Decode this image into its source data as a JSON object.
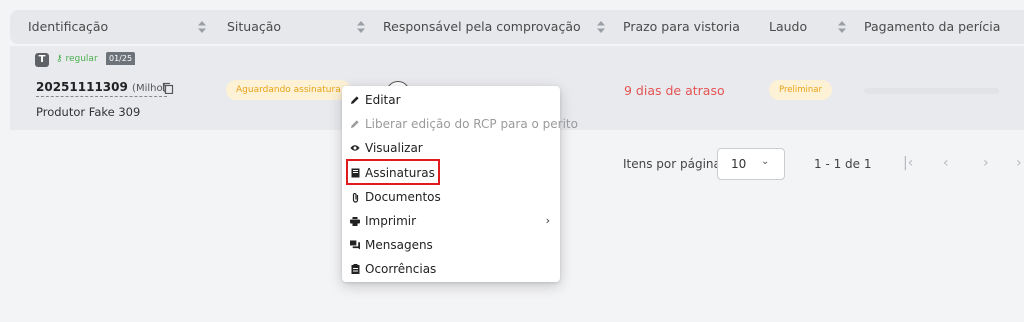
{
  "table": {
    "columns": [
      {
        "label": "Identificação"
      },
      {
        "label": "Situação"
      },
      {
        "label": "Responsável pela comprovação"
      },
      {
        "label": "Prazo para vistoria"
      },
      {
        "label": "Laudo"
      },
      {
        "label": "Pagamento da perícia"
      }
    ],
    "row": {
      "type_badge": "T",
      "regular_label": "regular",
      "count_badge": "01/25",
      "id_number": "20251111309",
      "crop": "(Milho)",
      "producer": "Produtor Fake 309",
      "status": "Aguardando assinatura",
      "deadline": "9 dias de atraso",
      "laudo": "Preliminar",
      "payment_progress": 0
    }
  },
  "pagination": {
    "items_per_page_label": "Itens por página",
    "items_per_page_value": "10",
    "range_label": "1 - 1 de 1"
  },
  "menu": {
    "items": [
      {
        "label": "Editar",
        "icon": "pencil-icon",
        "disabled": false
      },
      {
        "label": "Liberar edição do RCP para o perito",
        "icon": "pencil-icon",
        "disabled": true
      },
      {
        "label": "Visualizar",
        "icon": "eye-icon",
        "disabled": false
      },
      {
        "label": "Assinaturas",
        "icon": "book-icon",
        "disabled": false,
        "highlighted": true
      },
      {
        "label": "Documentos",
        "icon": "paperclip-icon",
        "disabled": false
      },
      {
        "label": "Imprimir",
        "icon": "printer-icon",
        "disabled": false,
        "submenu": true
      },
      {
        "label": "Mensagens",
        "icon": "chat-icon",
        "disabled": false
      },
      {
        "label": "Ocorrências",
        "icon": "clipboard-icon",
        "disabled": false
      }
    ]
  },
  "colors": {
    "status_text": "#e8a317",
    "status_bg": "#fdf1d6",
    "overdue": "#e55353",
    "highlight_border": "#e01b1b",
    "regular_green": "#4caf50"
  }
}
